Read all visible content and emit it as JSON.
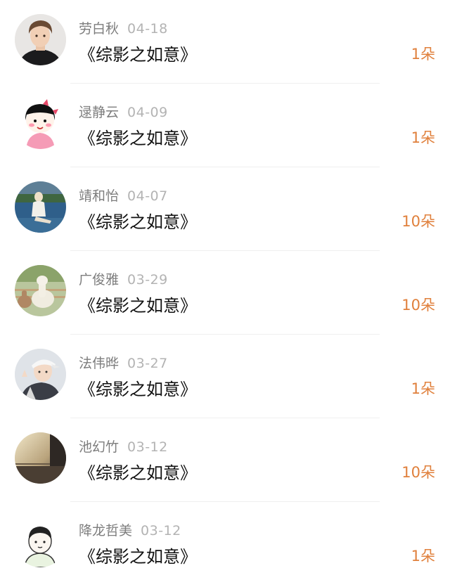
{
  "records": [
    {
      "name": "劳白秋",
      "date": "04-18",
      "title": "《综影之如意》",
      "amount": "1朵",
      "avatar_icon": "boy-black-hoodie-avatar"
    },
    {
      "name": "逯静云",
      "date": "04-09",
      "title": "《综影之如意》",
      "amount": "1朵",
      "avatar_icon": "cartoon-girl-avatar"
    },
    {
      "name": "靖和怡",
      "date": "04-07",
      "title": "《综影之如意》",
      "amount": "10朵",
      "avatar_icon": "seaside-person-avatar"
    },
    {
      "name": "广俊雅",
      "date": "03-29",
      "title": "《综影之如意》",
      "amount": "10朵",
      "avatar_icon": "alpaca-avatar"
    },
    {
      "name": "法伟晔",
      "date": "03-27",
      "title": "《综影之如意》",
      "amount": "1朵",
      "avatar_icon": "boy-cap-avatar"
    },
    {
      "name": "池幻竹",
      "date": "03-12",
      "title": "《综影之如意》",
      "amount": "10朵",
      "avatar_icon": "sunset-avatar"
    },
    {
      "name": "降龙哲美",
      "date": "03-12",
      "title": "《综影之如意》",
      "amount": "1朵",
      "avatar_icon": "cartoon-boy-avatar"
    }
  ],
  "colors": {
    "amount": "#e0803c",
    "name": "#7d7d7d",
    "date": "#b3b3b3"
  }
}
